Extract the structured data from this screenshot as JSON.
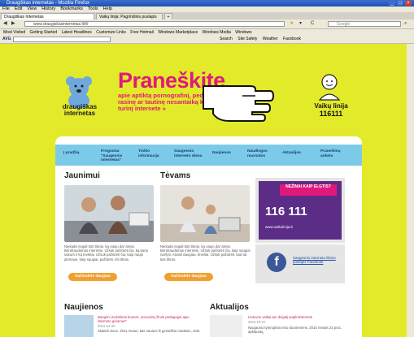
{
  "window": {
    "title": "Draugiškas internetas - Mozilla Firefox"
  },
  "menubar": [
    "File",
    "Edit",
    "View",
    "History",
    "Bookmarks",
    "Tools",
    "Help"
  ],
  "tabs": [
    {
      "label": "Draugiškas Internetas"
    },
    {
      "label": "Vaikų linija: Pagrindinis puslapis"
    }
  ],
  "tab_new": "+",
  "address": {
    "url": "www.draugiskasinternetas.lt/lt/",
    "search_placeholder": "Google"
  },
  "nav": {
    "back": "◀",
    "forward": "▶",
    "reload": "C"
  },
  "bookmarks": [
    "Most Visited",
    "Getting Started",
    "Latest Headlines",
    "Customize Links",
    "Free Hotmail",
    "Windows Marketplace",
    "Windows Media",
    "Windows"
  ],
  "avg": {
    "label": "AVG",
    "placeholder": "Search",
    "items": [
      "Search",
      "Site Safety",
      "Weather",
      "Facebook"
    ]
  },
  "site": {
    "brand": "draugiškas internetas",
    "headline": "Praneškite",
    "subhead": "apie aptiktą pornografinį, pedofilinį, rasinę ar tautinę nesantaiką kurstantį turinį internete »",
    "vaiku_name": "Vaikų linija",
    "vaiku_number": "116111",
    "menu": [
      "Į pradžią",
      "Programa \"Saugesnis internetas\"",
      "Tinklo informacija",
      "Saugesnio interneto diena",
      "Naujienos",
      "Naudingos nuorodos",
      "Aktualijos",
      "Pranešimų anketa"
    ],
    "jaunimui": {
      "title": "Jaunimui",
      "text": "Niekada negali būti tikras, ką nauju dar atrasi. Bendraudamas internete, Užsuk pažiūrėti čia, ką kartu sukurti ir ką tėveliai. Užsuk pažiūrėti čia, kaip naujo įdomaus, kaip saugiai, pažiūrėti, kiti tikras.",
      "button": "Sužinokite daugiau"
    },
    "tevams": {
      "title": "Tėvams",
      "text": "Niekada negali būti tikras, ką naujo dar atrasi. Bendraudamas internete, Užsuk pažiūrėti čia, kaip saugiai naršyti. Atrasti daugiau, tėveliai. Užsuk pažiūrėti, kad tai, kas tikras.",
      "button": "Sužinokite daugiau"
    },
    "badge": {
      "question": "NEŽINAI KAIP ELGTIS?",
      "number": "116 111",
      "url": "www.vaikulinija.lt"
    },
    "facebook": "Saugesnio interneto likimo puslapis Facebook",
    "naujienos": {
      "title": "Naujienos",
      "item_title": "Bangimi mokslimai buvnai: „Ką turėtų žinoti pedagogai apie interneto grėsmes\"",
      "item_date": "2011-12-20",
      "item_text": "Skaiteli visos. 2011 metus, kas nauieni iš geriaiškiu medasio, ntok."
    },
    "aktualijos": {
      "title": "Aktualijos",
      "item_title": "Lietuvos vaikai per dvigalį angliniinternete",
      "item_date": "2011-10-27",
      "item_text": "Naujausio tyrimųtinia rimo duomenims, 2010 metais 23 proc. apklaustų,"
    }
  },
  "colors": {
    "page_bg": "#e3ea2a",
    "accent_pink": "#e0187c",
    "menu_bg": "#7bcbe8",
    "button_orange": "#f0a030"
  }
}
